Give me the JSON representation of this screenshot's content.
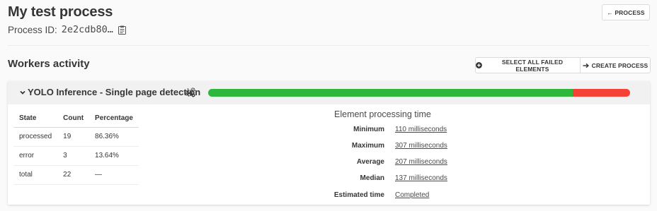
{
  "header": {
    "title": "My test process",
    "process_id_label": "Process ID:",
    "process_id_value": "2e2cdb80…",
    "process_button": "← PROCESS"
  },
  "section": {
    "title": "Workers activity",
    "select_failed_label": "SELECT ALL FAILED ELEMENTS",
    "create_process_label": "CREATE PROCESS"
  },
  "worker": {
    "name": "YOLO Inference - Single page detection",
    "progress": {
      "processed_fraction": 0.8636,
      "error_fraction": 0.1364
    },
    "colors": {
      "processed": "#2db83d",
      "error": "#f44336"
    },
    "states_table": {
      "headers": [
        "State",
        "Count",
        "Percentage"
      ],
      "rows": [
        [
          "processed",
          "19",
          "86.36%"
        ],
        [
          "error",
          "3",
          "13.64%"
        ],
        [
          "total",
          "22",
          "—"
        ]
      ]
    },
    "timing": {
      "title": "Element processing time",
      "rows": [
        {
          "label": "Minimum",
          "value": "110 milliseconds"
        },
        {
          "label": "Maximum",
          "value": "307 milliseconds"
        },
        {
          "label": "Average",
          "value": "207 milliseconds"
        },
        {
          "label": "Median",
          "value": "137 milliseconds"
        },
        {
          "label": "Estimated time",
          "value": "Completed"
        }
      ]
    }
  },
  "icons": {
    "clipboard": "clipboard-icon",
    "chevron": "chevron-down-icon",
    "cogs": "cogs-icon",
    "plus_circle": "plus-circle-icon",
    "arrow_right": "arrow-right-icon"
  }
}
